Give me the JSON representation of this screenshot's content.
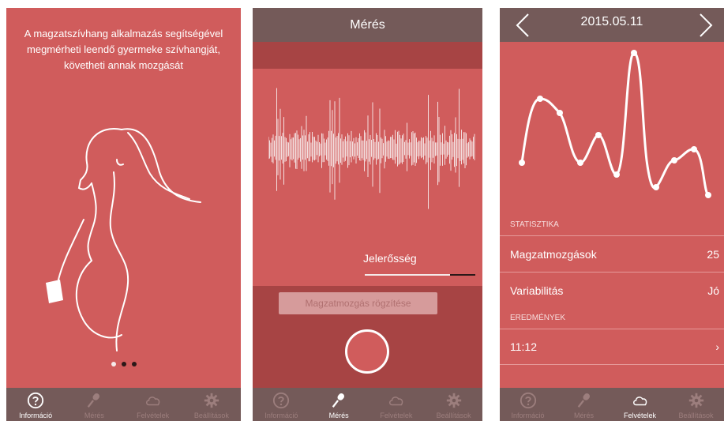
{
  "screen1": {
    "intro_text": "A magzatszívhang alkalmazás segítségével megmérheti leendő gyermeke szívhangját, követheti annak mozgását",
    "page_dots": {
      "count": 3,
      "active": 0
    }
  },
  "screen2": {
    "title": "Mérés",
    "signal_label": "Jelerősség",
    "record_movement_label": "Magzatmozgás rögzítése"
  },
  "screen3": {
    "date": "2015.05.11",
    "statistics_header": "STATISZTIKA",
    "rows": [
      {
        "label": "Magzatmozgások",
        "value": "25"
      },
      {
        "label": "Variabilitás",
        "value": "Jó"
      }
    ],
    "results_header": "EREDMÉNYEK",
    "result_item": {
      "label": "11:12",
      "chevron": "›"
    }
  },
  "tabs": {
    "info": "Információ",
    "measure": "Mérés",
    "recordings": "Felvételek",
    "settings": "Beállítások"
  },
  "colors": {
    "background": "#d05c5c",
    "navbar": "#745a59",
    "dark_band": "#a74444"
  }
}
